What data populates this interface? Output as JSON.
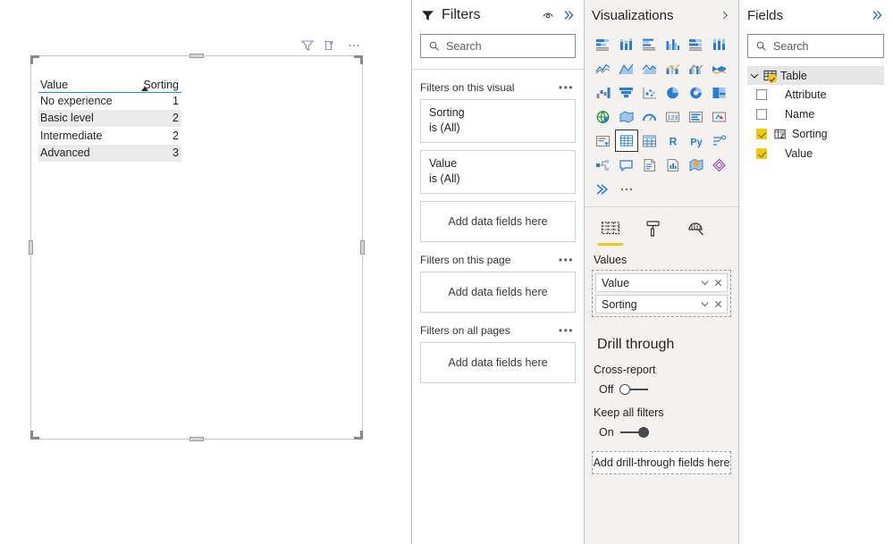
{
  "canvas": {
    "visual_header_icons": [
      "filter-icon",
      "focus-mode-icon",
      "more-options-icon"
    ],
    "table": {
      "columns": [
        "Value",
        "Sorting"
      ],
      "sort_column": "Sorting",
      "sort_direction": "ascending",
      "rows": [
        {
          "value": "No experience",
          "sorting": "1"
        },
        {
          "value": "Basic level",
          "sorting": "2"
        },
        {
          "value": "Intermediate",
          "sorting": "2"
        },
        {
          "value": "Advanced",
          "sorting": "3"
        }
      ]
    }
  },
  "filters": {
    "title": "Filters",
    "search_placeholder": "Search",
    "groups": [
      {
        "label": "Filters on this visual",
        "cards": [
          {
            "name": "Sorting",
            "value": "is (All)"
          },
          {
            "name": "Value",
            "value": "is (All)"
          }
        ],
        "drop_label": "Add data fields here"
      },
      {
        "label": "Filters on this page",
        "cards": [],
        "drop_label": "Add data fields here"
      },
      {
        "label": "Filters on all pages",
        "cards": [],
        "drop_label": "Add data fields here"
      }
    ]
  },
  "visualizations": {
    "title": "Visualizations",
    "selected_visual": "table-visual-icon",
    "icons": [
      "stacked-bar-chart-icon",
      "stacked-column-chart-icon",
      "clustered-bar-chart-icon",
      "clustered-column-chart-icon",
      "100-percent-stacked-bar-chart-icon",
      "100-percent-stacked-column-chart-icon",
      "line-chart-icon",
      "area-chart-icon",
      "stacked-area-chart-icon",
      "line-and-stacked-column-chart-icon",
      "line-and-clustered-column-chart-icon",
      "ribbon-chart-icon",
      "waterfall-chart-icon",
      "funnel-chart-icon",
      "scatter-chart-icon",
      "pie-chart-icon",
      "donut-chart-icon",
      "treemap-icon",
      "map-icon",
      "filled-map-icon",
      "gauge-icon",
      "card-icon",
      "multi-row-card-icon",
      "kpi-icon",
      "slicer-icon",
      "table-visual-icon",
      "matrix-icon",
      "r-script-visual-icon",
      "python-visual-icon",
      "key-influencers-icon",
      "decomposition-tree-icon",
      "q-and-a-icon",
      "paginated-report-icon",
      "smart-narrative-icon",
      "arcgis-map-icon",
      "power-apps-icon",
      "power-automate-icon",
      "more-visuals-icon"
    ],
    "tabs": [
      {
        "name": "fields-tab",
        "active": true
      },
      {
        "name": "format-tab",
        "active": false
      },
      {
        "name": "analytics-tab",
        "active": false
      }
    ],
    "wells_label": "Values",
    "wells": [
      "Value",
      "Sorting"
    ],
    "drill_through": {
      "title": "Drill through",
      "cross_report_label": "Cross-report",
      "cross_report_state": "Off",
      "keep_all_filters_label": "Keep all filters",
      "keep_all_filters_state": "On",
      "drop_label": "Add drill-through fields here"
    }
  },
  "fields": {
    "title": "Fields",
    "search_placeholder": "Search",
    "table_name": "Table",
    "items": [
      {
        "label": "Attribute",
        "checked": false,
        "has_sort_icon": false
      },
      {
        "label": "Name",
        "checked": false,
        "has_sort_icon": false
      },
      {
        "label": "Sorting",
        "checked": true,
        "has_sort_icon": true
      },
      {
        "label": "Value",
        "checked": true,
        "has_sort_icon": false
      }
    ]
  },
  "colors": {
    "accent_yellow": "#F2C811",
    "header_underline_blue": "#2A8AD4",
    "panel_gray": "#F3F2F1",
    "row_band": "#EAEAEA"
  }
}
